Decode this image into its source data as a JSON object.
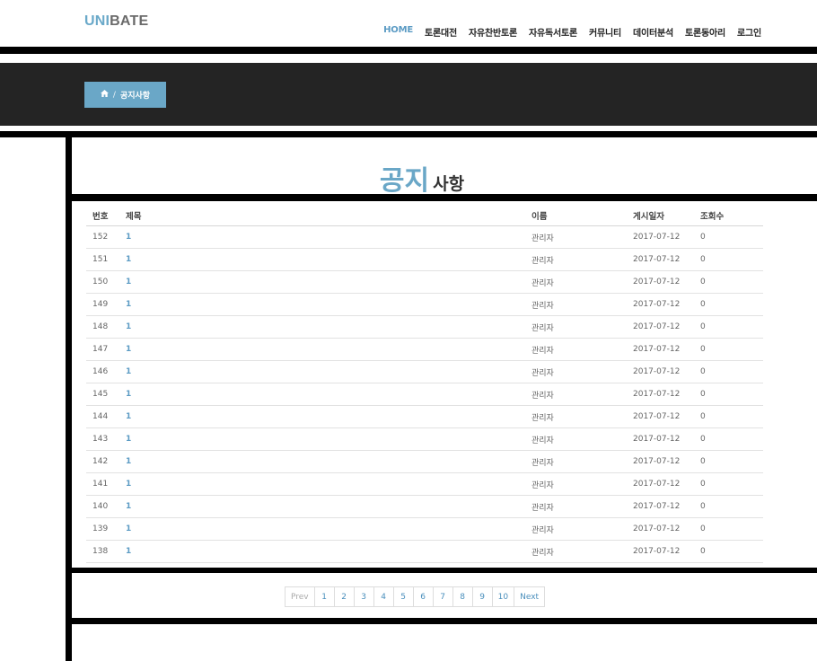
{
  "logo": {
    "part1": "UNI",
    "part2": "BATE"
  },
  "nav": [
    {
      "label": "HOME",
      "active": true
    },
    {
      "label": "토론대전"
    },
    {
      "label": "자유찬반토론"
    },
    {
      "label": "자유독서토론"
    },
    {
      "label": "커뮤니티"
    },
    {
      "label": "데이터분석"
    },
    {
      "label": "토론동아리"
    },
    {
      "label": "로그인"
    }
  ],
  "breadcrumb": {
    "icon": "home-icon",
    "separator": "/",
    "label": "공지사항"
  },
  "page_title": {
    "part1": "공지",
    "part2": "사항"
  },
  "table": {
    "headers": {
      "no": "번호",
      "title": "제목",
      "name": "이름",
      "date": "게시일자",
      "views": "조회수"
    },
    "rows": [
      {
        "no": "152",
        "title": "1",
        "name": "관리자",
        "date": "2017-07-12",
        "views": "0"
      },
      {
        "no": "151",
        "title": "1",
        "name": "관리자",
        "date": "2017-07-12",
        "views": "0"
      },
      {
        "no": "150",
        "title": "1",
        "name": "관리자",
        "date": "2017-07-12",
        "views": "0"
      },
      {
        "no": "149",
        "title": "1",
        "name": "관리자",
        "date": "2017-07-12",
        "views": "0"
      },
      {
        "no": "148",
        "title": "1",
        "name": "관리자",
        "date": "2017-07-12",
        "views": "0"
      },
      {
        "no": "147",
        "title": "1",
        "name": "관리자",
        "date": "2017-07-12",
        "views": "0"
      },
      {
        "no": "146",
        "title": "1",
        "name": "관리자",
        "date": "2017-07-12",
        "views": "0"
      },
      {
        "no": "145",
        "title": "1",
        "name": "관리자",
        "date": "2017-07-12",
        "views": "0"
      },
      {
        "no": "144",
        "title": "1",
        "name": "관리자",
        "date": "2017-07-12",
        "views": "0"
      },
      {
        "no": "143",
        "title": "1",
        "name": "관리자",
        "date": "2017-07-12",
        "views": "0"
      },
      {
        "no": "142",
        "title": "1",
        "name": "관리자",
        "date": "2017-07-12",
        "views": "0"
      },
      {
        "no": "141",
        "title": "1",
        "name": "관리자",
        "date": "2017-07-12",
        "views": "0"
      },
      {
        "no": "140",
        "title": "1",
        "name": "관리자",
        "date": "2017-07-12",
        "views": "0"
      },
      {
        "no": "139",
        "title": "1",
        "name": "관리자",
        "date": "2017-07-12",
        "views": "0"
      },
      {
        "no": "138",
        "title": "1",
        "name": "관리자",
        "date": "2017-07-12",
        "views": "0"
      }
    ]
  },
  "pagination": {
    "prev": "Prev",
    "pages": [
      "1",
      "2",
      "3",
      "4",
      "5",
      "6",
      "7",
      "8",
      "9",
      "10"
    ],
    "next": "Next"
  },
  "colors": {
    "accent": "#6aa7c7",
    "banner": "#242424",
    "link": "#5b9bc4"
  }
}
